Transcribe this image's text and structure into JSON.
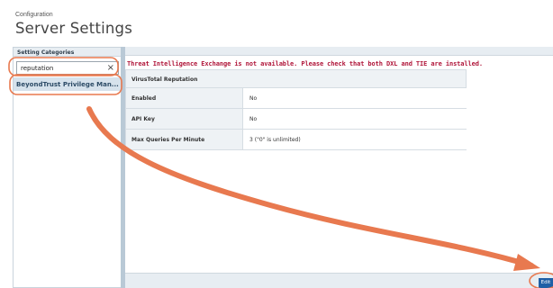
{
  "header": {
    "breadcrumb": "Configuration",
    "title": "Server Settings"
  },
  "sidebar": {
    "heading": "Setting Categories",
    "search": {
      "value": "reputation",
      "clear_icon": "×"
    },
    "items": [
      {
        "label": "BeyondTrust Privilege Man..."
      }
    ]
  },
  "main": {
    "warning": "Threat Intelligence Exchange is not available. Please check that both DXL and TIE are installed.",
    "section_title": "VirusTotal Reputation",
    "rows": [
      {
        "label": "Enabled",
        "value": "No"
      },
      {
        "label": "API Key",
        "value": "No"
      },
      {
        "label": "Max Queries Per Minute",
        "value": "3 (\"0\" is unlimited)"
      }
    ]
  },
  "footer": {
    "edit_label": "Edit"
  },
  "annotation": {
    "color": "#e8794f"
  }
}
